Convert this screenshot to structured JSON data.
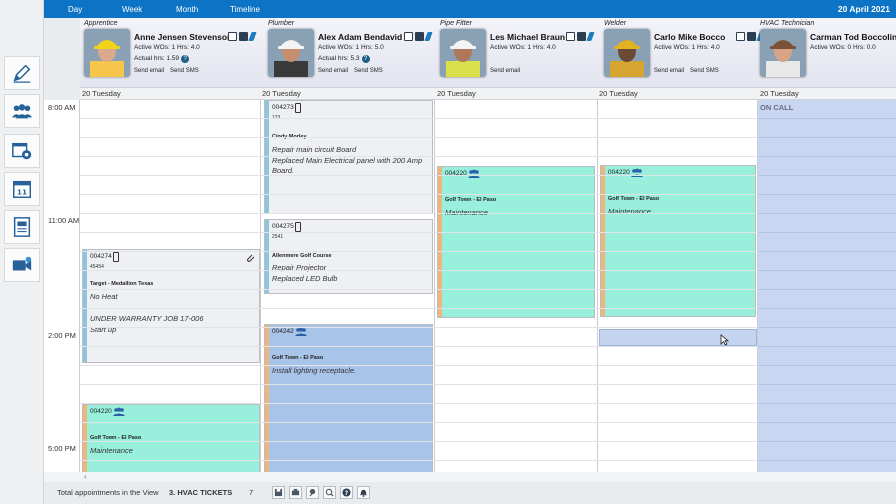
{
  "topbar": {
    "tabs": [
      "Day",
      "Week",
      "Month",
      "Timeline"
    ],
    "date": "20 April 2021"
  },
  "technicians": [
    {
      "role": "Apprentice",
      "name": "Anne Jensen Stevenson",
      "stats": "Active WOs: 1 Hrs: 4.0",
      "actual": "Actual hrs: 1.59",
      "links": [
        "Send email",
        "Send SMS"
      ],
      "skin": "#d9a98a",
      "hat": "#f2d21a",
      "shirt": "#f5c64a"
    },
    {
      "role": "Plumber",
      "name": "Alex Adam Bendavid",
      "stats": "Active WOs: 1 Hrs: 5.0",
      "actual": "Actual hrs: 5.3",
      "links": [
        "Send email",
        "Send SMS"
      ],
      "skin": "#c58e6e",
      "hat": "#f4f4f4",
      "shirt": "#3a3a3a"
    },
    {
      "role": "Pipe Fitter",
      "name": "Les Michael Braun",
      "stats": "Active WOs: 1 Hrs: 4.0",
      "actual": "",
      "links": [
        "Send email"
      ],
      "skin": "#b07858",
      "hat": "#f4f4f4",
      "shirt": "#d9e04a"
    },
    {
      "role": "Welder",
      "name": "Carlo Mike Bocco",
      "stats": "Active WOs: 1 Hrs: 4.0",
      "actual": "",
      "links": [
        "Send email",
        "Send SMS"
      ],
      "skin": "#6b4a35",
      "hat": "#e1b323",
      "shirt": "#d6a531"
    },
    {
      "role": "HVAC Technician",
      "name": "Carman Tod Boccolini",
      "stats": "Active WOs: 0 Hrs: 0.0",
      "actual": "",
      "links": [],
      "skin": "#d8a488",
      "hat": "#7a5237",
      "shirt": "#e8e8e8"
    }
  ],
  "days": [
    "20 Tuesday",
    "20 Tuesday",
    "20 Tuesday",
    "20 Tuesday",
    "20 Tuesday"
  ],
  "oncall": "ON CALL",
  "times": [
    "8:00 AM",
    "11:00 AM",
    "2:00 PM",
    "5:00 PM"
  ],
  "appointments": [
    {
      "col": 1,
      "code": "004273",
      "sub": "123",
      "customer": "Cindy Morley",
      "desc": [
        "Repair main circuit Board",
        "Replaced Main Electrical panel with 200 Amp Board."
      ],
      "bg": "#eef0f3",
      "bar": "#8bc5e0",
      "icon": "phone"
    },
    {
      "col": 1,
      "code": "004275",
      "sub": "2541",
      "customer": "Allenmere Golf Course",
      "desc": [
        "Repair Projector",
        "Replaced LED Bulb"
      ],
      "bg": "#eef0f3",
      "bar": "#8bc5e0",
      "icon": "phone"
    },
    {
      "col": 1,
      "code": "004242",
      "sub": "",
      "customer": "Golf Town - El Paso",
      "desc": [
        "Install lighting receptacle."
      ],
      "bg": "#a8c4e8",
      "bar": "#f0b57b",
      "icon": "team"
    },
    {
      "col": 0,
      "code": "004274",
      "sub": "45454",
      "customer": "Target - Medallion Texas",
      "desc": [
        "No Heat",
        "",
        "UNDER WARRANTY JOB 17-006",
        "Start up"
      ],
      "bg": "#eef0f3",
      "bar": "#8bc5e0",
      "icon": "phone"
    },
    {
      "col": 0,
      "code": "004220",
      "sub": "",
      "customer": "Golf Town - El Paso",
      "desc": [
        "Maintenance"
      ],
      "bg": "#98f0dc",
      "bar": "#f0b57b",
      "icon": "team"
    },
    {
      "col": 2,
      "code": "004220",
      "sub": "",
      "customer": "Golf Town - El Paso",
      "desc": [
        "Maintenance"
      ],
      "bg": "#98f0dc",
      "bar": "#f0b57b",
      "icon": "team"
    },
    {
      "col": 3,
      "code": "004220",
      "sub": "",
      "customer": "Golf Town - El Paso",
      "desc": [
        "Maintenance"
      ],
      "bg": "#98f0dc",
      "bar": "#f0b57b",
      "icon": "team"
    }
  ],
  "footer": {
    "label": "Total appointments in the View",
    "tickets": "3. HVAC TICKETS",
    "count": "7"
  },
  "colors": {
    "accent": "#0d73c5",
    "oncall": "#c8d6f2"
  },
  "icons": [
    "edit-icon",
    "users-icon",
    "schedule-settings-icon",
    "calendar-icon",
    "report-icon",
    "video-icon"
  ]
}
